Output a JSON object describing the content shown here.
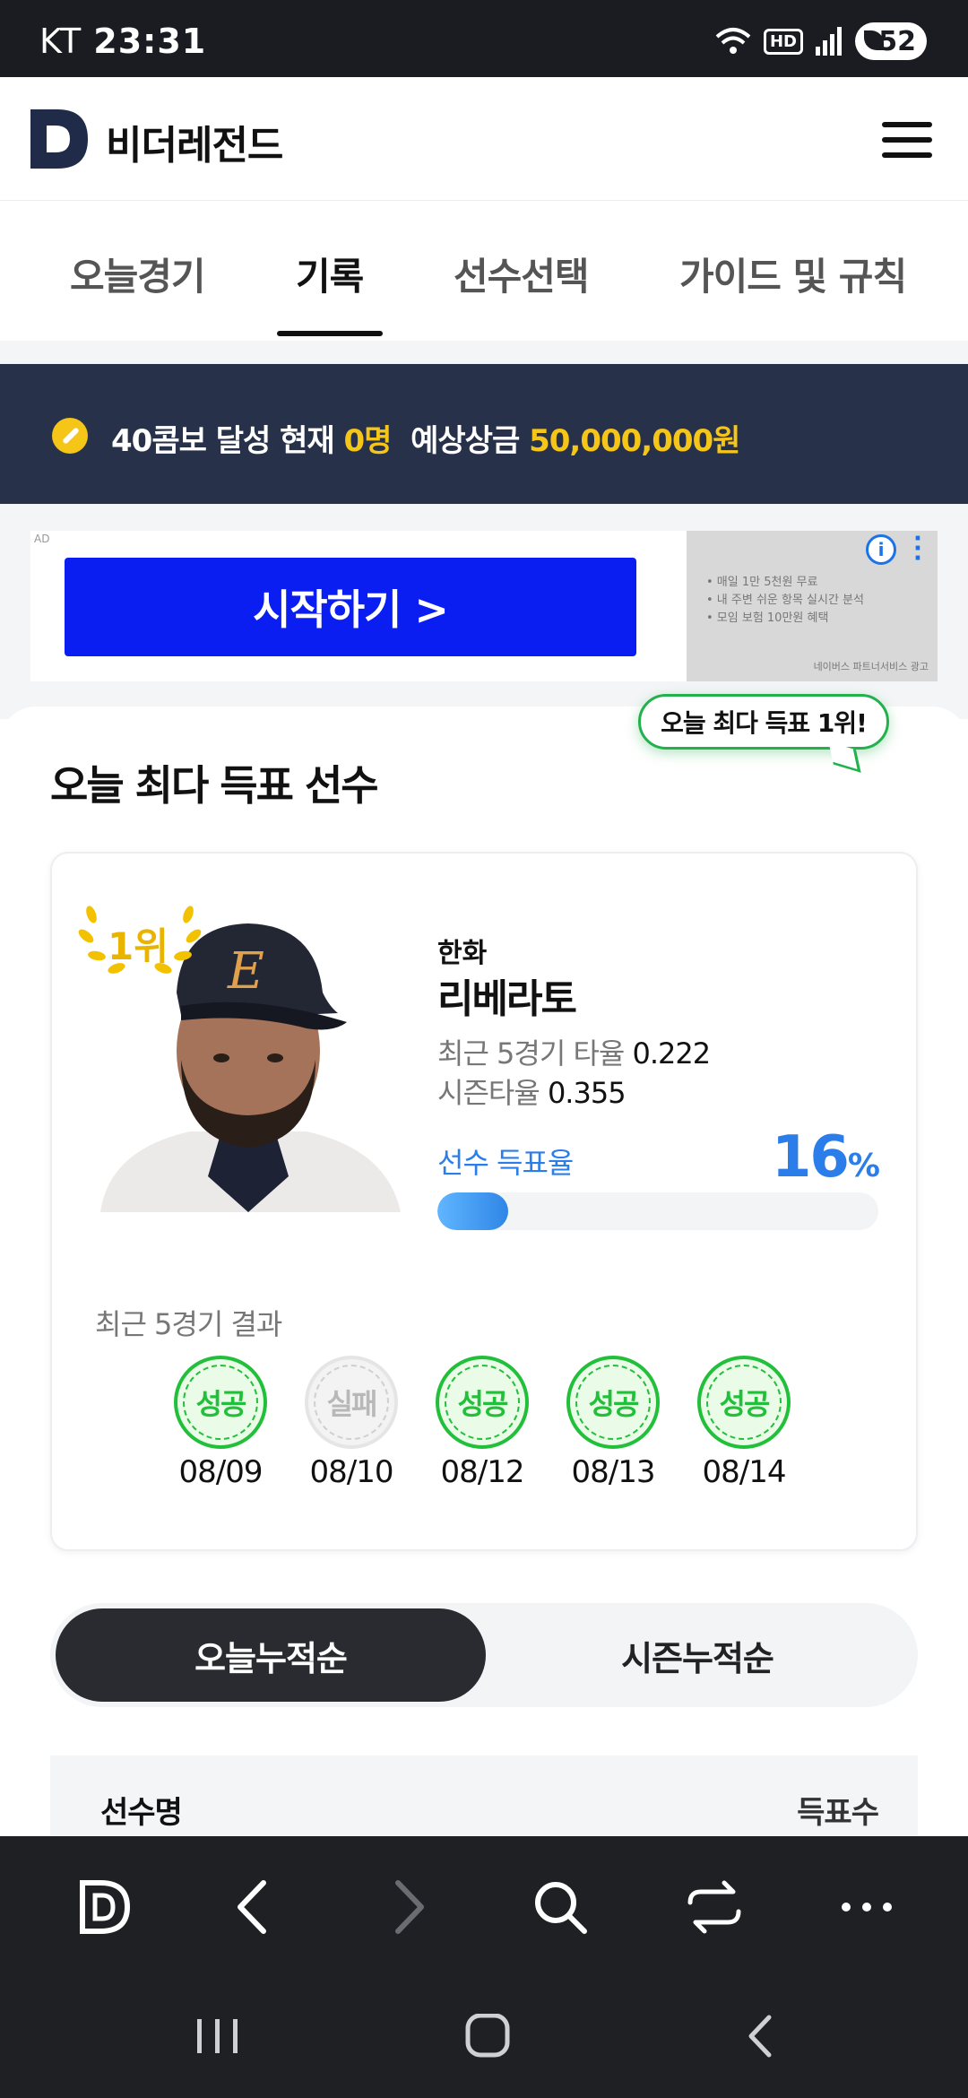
{
  "status_bar": {
    "carrier": "KT",
    "time": "23:31",
    "battery": "52",
    "hd": "HD"
  },
  "header": {
    "brand": "비더레전드",
    "menu_icon": "hamburger-icon"
  },
  "tabs": [
    {
      "label": "오늘경기",
      "active": false
    },
    {
      "label": "기록",
      "active": true
    },
    {
      "label": "선수선택",
      "active": false
    },
    {
      "label": "가이드 및 규칙",
      "active": false
    }
  ],
  "banner": {
    "prefix": "40콤보 달성 현재 ",
    "count": "0명",
    "middle": "  예상상금 ",
    "prize": "50,000,000원"
  },
  "ad": {
    "tag": "AD",
    "cta": "시작하기 >",
    "side_lines": [
      "• 매일 1만 5천원 무료",
      "• 내 주변 쉬운 항목 실시간 분석",
      "• 모임 보험 10만원 혜택"
    ],
    "side_footer": "네이버스 파트너서비스 광고",
    "info": "i"
  },
  "featured": {
    "bubble": "오늘 최다 득표 1위!",
    "title": "오늘 최다 득표 선수",
    "rank": "1위",
    "team": "한화",
    "name": "리베라토",
    "recent_avg_label": "최근 5경기 타율 ",
    "recent_avg": "0.222",
    "season_avg_label": "시즌타율 ",
    "season_avg": "0.355",
    "vote_label": "선수 득표율",
    "vote_pct": "16",
    "vote_unit": "%",
    "vote_fraction": 0.16,
    "recent_label": "최근 5경기 결과",
    "games": [
      {
        "result": "성공",
        "date": "08/09",
        "success": true
      },
      {
        "result": "실패",
        "date": "08/10",
        "success": false
      },
      {
        "result": "성공",
        "date": "08/12",
        "success": true
      },
      {
        "result": "성공",
        "date": "08/13",
        "success": true
      },
      {
        "result": "성공",
        "date": "08/14",
        "success": true
      }
    ]
  },
  "toggle": {
    "on": "오늘누적순",
    "off": "시즌누적순"
  },
  "table": {
    "col_name": "선수명",
    "col_votes": "득표수"
  },
  "browser": {
    "icons": [
      "home-icon",
      "back-icon",
      "forward-icon",
      "search-icon",
      "tabs-icon",
      "more-icon"
    ]
  },
  "navbar": {
    "icons": [
      "recent-apps-icon",
      "home-circle-icon",
      "back-chevron-icon"
    ]
  }
}
